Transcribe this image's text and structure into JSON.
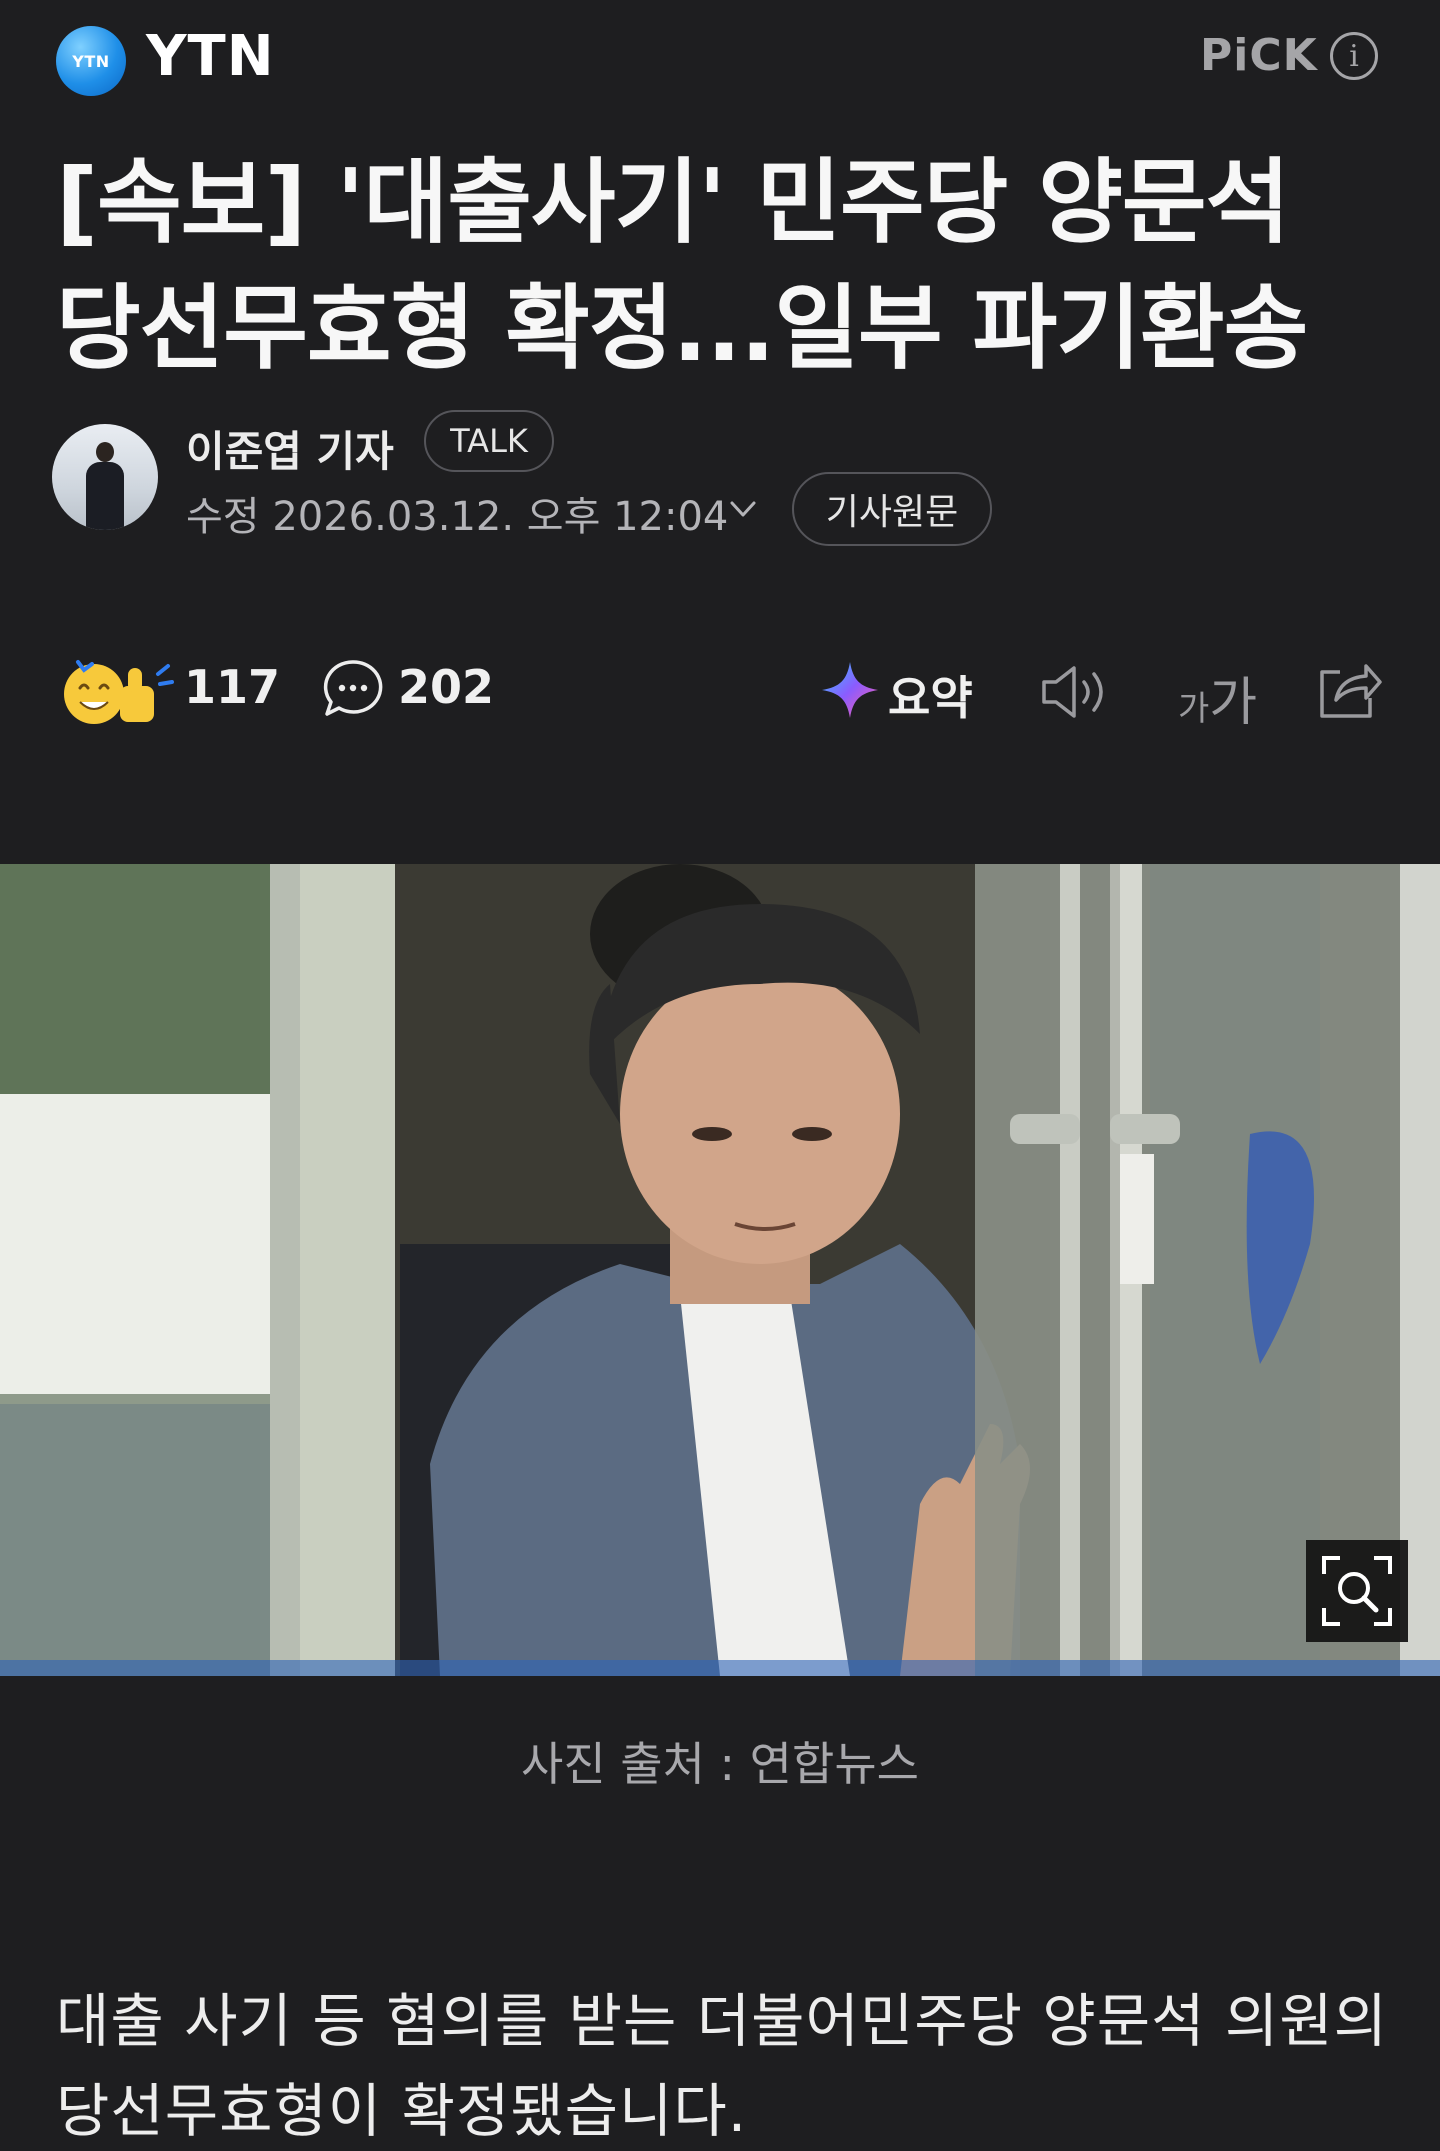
{
  "header": {
    "press_logo_text": "YTN",
    "press_name": "YTN",
    "pick_label": "PiCK",
    "info_icon": "i"
  },
  "article": {
    "headline": "[속보] '대출사기' 민주당 양문석 당선무효형 확정...일부 파기환송",
    "reporter": "이준엽 기자",
    "talk_label": "TALK",
    "modified": "수정 2026.03.12. 오후 12:04",
    "origin_label": "기사원문",
    "reactions_count": "117",
    "comments_count": "202",
    "summary_label": "요약",
    "fontsize_small": "가",
    "fontsize_large": "가",
    "photo_caption": "사진 출처 : 연합뉴스",
    "body": "대출 사기 등 혐의를 받는 더불어민주당 양문석 의원의 당선무효형이 확정됐습니다."
  },
  "icons": {
    "reaction": "smile-thumbs-up-icon",
    "comment": "speech-bubble-icon",
    "summary": "sparkle-icon",
    "speaker": "speaker-icon",
    "fontsize": "font-size-icon",
    "share": "share-icon",
    "zoom": "zoom-icon"
  },
  "colors": {
    "background": "#1e1e20",
    "press_logo_blue": "#1f8fe8"
  }
}
